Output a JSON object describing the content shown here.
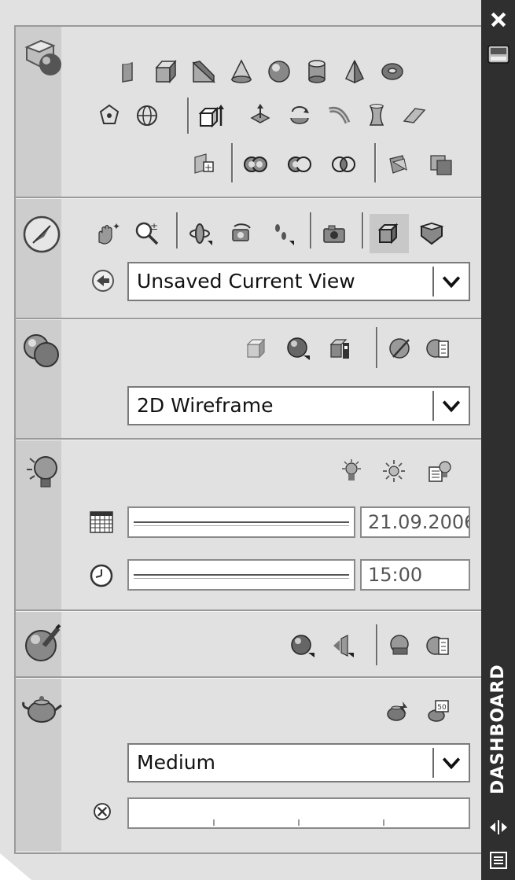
{
  "sidebar": {
    "title": "DASHBOARD",
    "close_icon": "close-icon",
    "properties_icon": "properties-icon",
    "autohide_icon": "auto-hide-icon",
    "menu_icon": "menu-icon"
  },
  "view": {
    "named_view": "Unsaved Current View"
  },
  "visual_style": {
    "current": "2D Wireframe"
  },
  "lights": {
    "date": "21.09.2006",
    "time": "15:00"
  },
  "render": {
    "preset": "Medium"
  },
  "colors": {
    "panel_bg": "#e1e1e1",
    "gutter_bg": "#cdcdcd",
    "sidebar_bg": "#2f2f2f"
  }
}
